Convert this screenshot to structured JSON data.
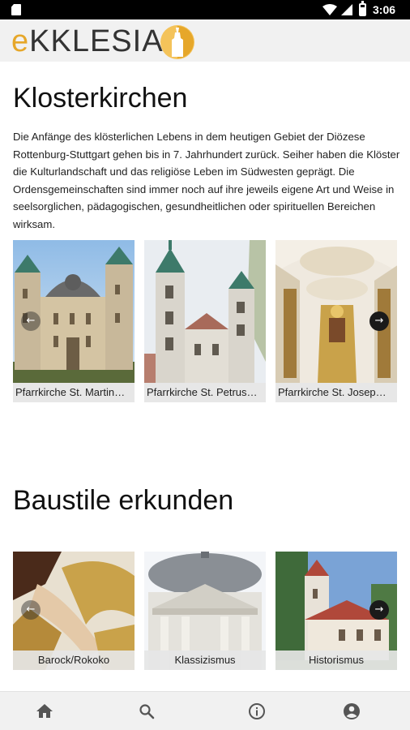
{
  "status_bar": {
    "time": "3:06"
  },
  "app_bar": {
    "logo_prefix": "e",
    "logo_rest": "KKLESIA"
  },
  "section_monasteries": {
    "title": "Klosterkirchen",
    "description": "Die Anfänge des klösterlichen Lebens in dem heutigen Gebiet der Diözese Rottenburg-Stuttgart gehen bis in 7. Jahrhundert zurück. Seiher haben die Klöster die Kulturlandschaft und das religiöse Leben im Südwesten geprägt. Die Ordensgemeinschaften sind immer noch auf ihre jeweils eigene Art und Weise in seelsorglichen, pädagogischen, gesundheitlichen oder spirituellen Bereichen wirksam.",
    "cards": [
      {
        "caption": "Pfarrkirche St. Martin…"
      },
      {
        "caption": "Pfarrkirche St. Petrus…"
      },
      {
        "caption": "Pfarrkirche St. Josep…"
      }
    ],
    "prev_icon": "arrow-left-icon",
    "next_icon": "arrow-right-icon"
  },
  "section_styles": {
    "title": "Baustile erkunden",
    "cards": [
      {
        "caption": "Barock/Rokoko"
      },
      {
        "caption": "Klassizismus"
      },
      {
        "caption": "Historismus"
      }
    ],
    "prev_icon": "arrow-left-icon",
    "next_icon": "arrow-right-icon"
  },
  "bottom_nav": {
    "items": [
      {
        "icon": "home-icon"
      },
      {
        "icon": "search-icon"
      },
      {
        "icon": "info-icon"
      },
      {
        "icon": "account-icon"
      }
    ]
  },
  "colors": {
    "accent": "#e6a72a",
    "bar_bg": "#f1f1f1",
    "status_bg": "#000000"
  }
}
